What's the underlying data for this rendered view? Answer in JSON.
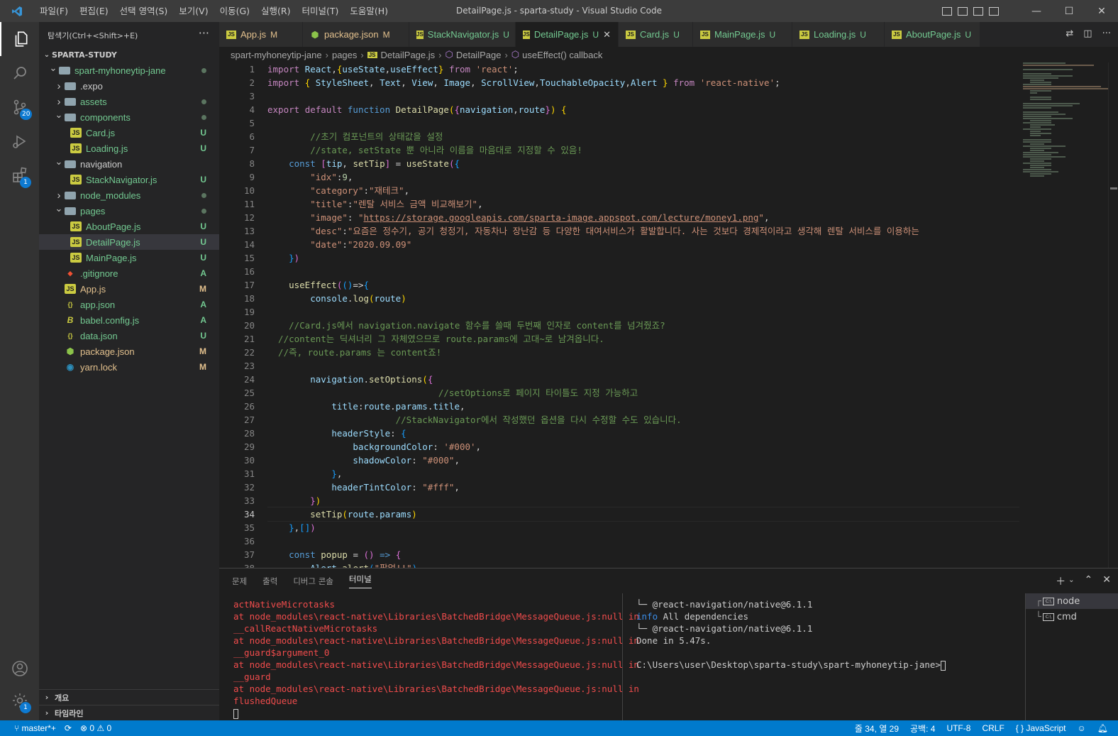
{
  "window": {
    "title": "DetailPage.js - sparta-study - Visual Studio Code",
    "menu": [
      "파일(F)",
      "편집(E)",
      "선택 영역(S)",
      "보기(V)",
      "이동(G)",
      "실행(R)",
      "터미널(T)",
      "도움말(H)"
    ]
  },
  "activity": {
    "source_control_badge": "20",
    "extensions_badge": "1",
    "settings_badge": "1"
  },
  "sidebar": {
    "tooltip": "탐색기(Ctrl+<Shift>+E)",
    "more": "···",
    "section_title": "SPARTA-STUDY",
    "tree": [
      {
        "label": "spart-myhoneytip-jane",
        "indent": 1,
        "type": "folder-open",
        "status": "",
        "dot": true
      },
      {
        "label": ".expo",
        "indent": 2,
        "type": "folder",
        "status": "",
        "dot": false
      },
      {
        "label": "assets",
        "indent": 2,
        "type": "folder",
        "status": "",
        "dot": true
      },
      {
        "label": "components",
        "indent": 2,
        "type": "folder-open",
        "status": "",
        "dot": true
      },
      {
        "label": "Card.js",
        "indent": 3,
        "type": "js",
        "status": "U"
      },
      {
        "label": "Loading.js",
        "indent": 3,
        "type": "js",
        "status": "U"
      },
      {
        "label": "navigation",
        "indent": 2,
        "type": "folder-open",
        "status": "",
        "dot": false
      },
      {
        "label": "StackNavigator.js",
        "indent": 3,
        "type": "js",
        "status": "U"
      },
      {
        "label": "node_modules",
        "indent": 2,
        "type": "folder",
        "status": "",
        "dot": true
      },
      {
        "label": "pages",
        "indent": 2,
        "type": "folder-open",
        "status": "",
        "dot": true
      },
      {
        "label": "AboutPage.js",
        "indent": 3,
        "type": "js",
        "status": "U"
      },
      {
        "label": "DetailPage.js",
        "indent": 3,
        "type": "js",
        "status": "U",
        "selected": true
      },
      {
        "label": "MainPage.js",
        "indent": 3,
        "type": "js",
        "status": "U"
      },
      {
        "label": ".gitignore",
        "indent": 2,
        "type": "git",
        "status": "A"
      },
      {
        "label": "App.js",
        "indent": 2,
        "type": "js",
        "status": "M"
      },
      {
        "label": "app.json",
        "indent": 2,
        "type": "json",
        "status": "A"
      },
      {
        "label": "babel.config.js",
        "indent": 2,
        "type": "babel",
        "status": "A"
      },
      {
        "label": "data.json",
        "indent": 2,
        "type": "json",
        "status": "U"
      },
      {
        "label": "package.json",
        "indent": 2,
        "type": "npm",
        "status": "M"
      },
      {
        "label": "yarn.lock",
        "indent": 2,
        "type": "yarn",
        "status": "M"
      }
    ],
    "outline_label": "개요",
    "timeline_label": "타임라인"
  },
  "tabs": [
    {
      "label": "App.js",
      "status": "M",
      "icon": "JS"
    },
    {
      "label": "package.json",
      "status": "M",
      "icon": "npm"
    },
    {
      "label": "StackNavigator.js",
      "status": "U",
      "icon": "JS"
    },
    {
      "label": "DetailPage.js",
      "status": "U",
      "icon": "JS",
      "active": true
    },
    {
      "label": "Card.js",
      "status": "U",
      "icon": "JS"
    },
    {
      "label": "MainPage.js",
      "status": "U",
      "icon": "JS"
    },
    {
      "label": "Loading.js",
      "status": "U",
      "icon": "JS"
    },
    {
      "label": "AboutPage.js",
      "status": "U",
      "icon": "JS"
    }
  ],
  "breadcrumb": [
    "spart-myhoneytip-jane",
    "pages",
    "DetailPage.js",
    "DetailPage",
    "useEffect() callback"
  ],
  "editor": {
    "current_line": 34,
    "line_numbers": [
      "1",
      "2",
      "3",
      "4",
      "5",
      "6",
      "7",
      "8",
      "9",
      "10",
      "11",
      "12",
      "13",
      "14",
      "15",
      "16",
      "17",
      "18",
      "19",
      "20",
      "21",
      "22",
      "23",
      "24",
      "25",
      "26",
      "27",
      "28",
      "29",
      "30",
      "31",
      "32",
      "33",
      "34",
      "35",
      "36",
      "37",
      "38"
    ]
  },
  "panel": {
    "tabs": [
      "문제",
      "출력",
      "디버그 콘솔",
      "터미널"
    ],
    "active_tab": "터미널",
    "terminal_left": [
      "actNativeMicrotasks",
      "at node_modules\\react-native\\Libraries\\BatchedBridge\\MessageQueue.js:null in",
      "__callReactNativeMicrotasks",
      "at node_modules\\react-native\\Libraries\\BatchedBridge\\MessageQueue.js:null in",
      "__guard$argument_0",
      "at node_modules\\react-native\\Libraries\\BatchedBridge\\MessageQueue.js:null in",
      "__guard",
      "at node_modules\\react-native\\Libraries\\BatchedBridge\\MessageQueue.js:null in",
      "flushedQueue"
    ],
    "terminal_right": {
      "line1": "└─ @react-navigation/native@6.1.1",
      "info_tag": "info",
      "line2": " All dependencies",
      "line3": "└─ @react-navigation/native@6.1.1",
      "line4": "Done in 5.47s.",
      "prompt": "C:\\Users\\user\\Desktop\\sparta-study\\spart-myhoneytip-jane>"
    },
    "terminals": [
      "node",
      "cmd"
    ]
  },
  "statusbar": {
    "branch": "master*+",
    "errors": "0",
    "warnings": "0",
    "position": "줄 34, 열 29",
    "spaces": "공백: 4",
    "encoding": "UTF-8",
    "eol": "CRLF",
    "language": "JavaScript"
  },
  "colors": {
    "statusbar": "#007acc",
    "untracked": "#73c991",
    "modified": "#e2c08d",
    "error_text": "#f14c4c"
  }
}
